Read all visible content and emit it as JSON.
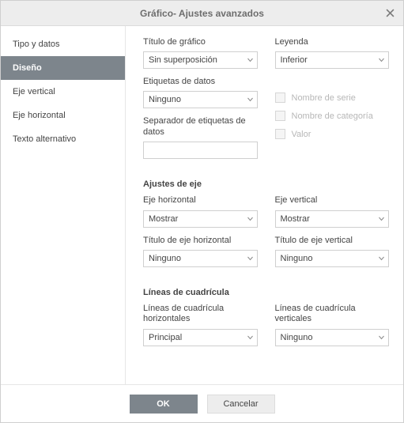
{
  "window": {
    "title": "Gráfico- Ajustes avanzados"
  },
  "sidebar": {
    "items": [
      {
        "label": "Tipo y datos"
      },
      {
        "label": "Diseño"
      },
      {
        "label": "Eje vertical"
      },
      {
        "label": "Eje horizontal"
      },
      {
        "label": "Texto alternativo"
      }
    ],
    "activeIndex": 1
  },
  "layout": {
    "chartTitle": {
      "label": "Título de gráfico",
      "value": "Sin superposición"
    },
    "legend": {
      "label": "Leyenda",
      "value": "Inferior"
    },
    "dataLabels": {
      "label": "Etiquetas de datos",
      "value": "Ninguno"
    },
    "dataLabelsSeparator": {
      "label": "Separador de etiquetas de datos",
      "value": ""
    },
    "checks": {
      "seriesName": "Nombre de serie",
      "categoryName": "Nombre de categoría",
      "value": "Valor"
    },
    "axisSettingsTitle": "Ajustes de eje",
    "horizAxis": {
      "label": "Eje horizontal",
      "value": "Mostrar"
    },
    "vertAxis": {
      "label": "Eje vertical",
      "value": "Mostrar"
    },
    "horizAxisTitle": {
      "label": "Título de eje horizontal",
      "value": "Ninguno"
    },
    "vertAxisTitle": {
      "label": "Título de eje vertical",
      "value": "Ninguno"
    },
    "gridlinesTitle": "Líneas de cuadrícula",
    "horizGrid": {
      "label": "Líneas de cuadrícula horizontales",
      "value": "Principal"
    },
    "vertGrid": {
      "label": "Líneas de cuadrícula verticales",
      "value": "Ninguno"
    }
  },
  "footer": {
    "ok": "OK",
    "cancel": "Cancelar"
  }
}
